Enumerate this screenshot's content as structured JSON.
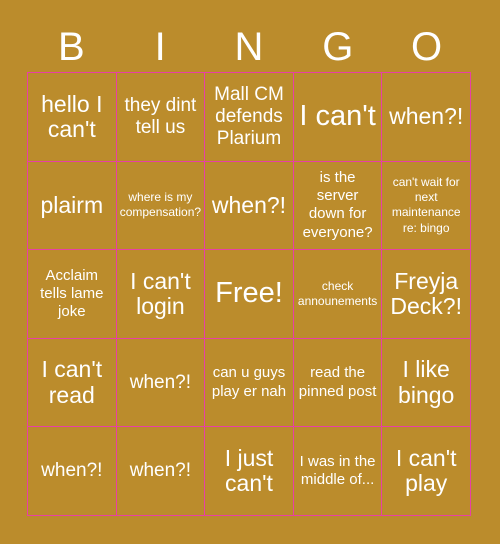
{
  "colors": {
    "background": "#bb8c2c",
    "border": "#e840a4",
    "text": "#ffffff"
  },
  "header": {
    "letters": [
      "B",
      "I",
      "N",
      "G",
      "O"
    ]
  },
  "grid": {
    "rows": 5,
    "columns": 5,
    "cells": [
      {
        "text": "hello I can't",
        "size": "lg"
      },
      {
        "text": "they dint tell us",
        "size": "md"
      },
      {
        "text": "Mall CM defends Plarium",
        "size": "md"
      },
      {
        "text": "I can't",
        "size": "xl"
      },
      {
        "text": "when?!",
        "size": "lg"
      },
      {
        "text": "plairm",
        "size": "lg"
      },
      {
        "text": "where is my compensation?",
        "size": "xs"
      },
      {
        "text": "when?!",
        "size": "lg"
      },
      {
        "text": "is the server down for everyone?",
        "size": "sm"
      },
      {
        "text": "can't wait for next maintenance re: bingo",
        "size": "xs"
      },
      {
        "text": "Acclaim tells lame joke",
        "size": "sm"
      },
      {
        "text": "I can't login",
        "size": "lg"
      },
      {
        "text": "Free!",
        "size": "xl"
      },
      {
        "text": "check announements",
        "size": "xs"
      },
      {
        "text": "Freyja Deck?!",
        "size": "lg"
      },
      {
        "text": "I can't read",
        "size": "lg"
      },
      {
        "text": "when?!",
        "size": "md"
      },
      {
        "text": "can u guys play er nah",
        "size": "sm"
      },
      {
        "text": "read the pinned post",
        "size": "sm"
      },
      {
        "text": "I like bingo",
        "size": "lg"
      },
      {
        "text": "when?!",
        "size": "md"
      },
      {
        "text": "when?!",
        "size": "md"
      },
      {
        "text": "I just can't",
        "size": "lg"
      },
      {
        "text": "I was in the middle of...",
        "size": "sm"
      },
      {
        "text": "I can't play",
        "size": "lg"
      }
    ]
  }
}
